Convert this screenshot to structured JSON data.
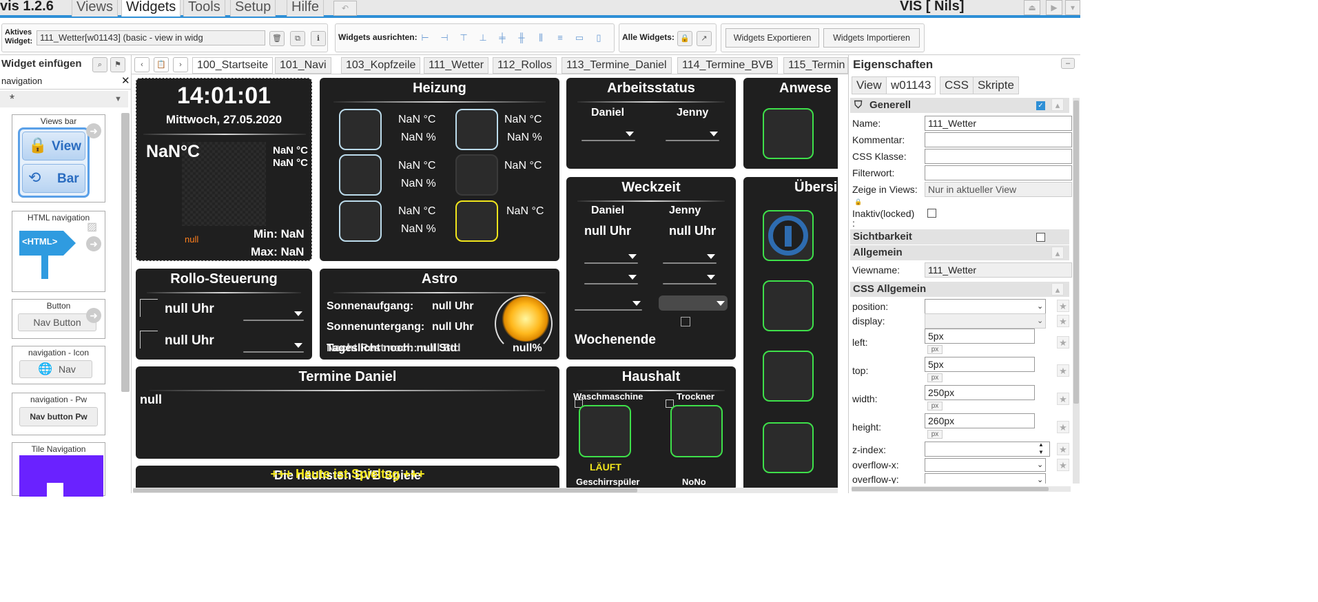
{
  "app": {
    "name": "vis 1.2.6",
    "user_title": "VIS [ Nils]"
  },
  "menu": {
    "tabs": [
      "Views",
      "Widgets",
      "Tools",
      "Setup",
      "Hilfe"
    ],
    "active": "Widgets"
  },
  "toolbar": {
    "active_widget_label_1": "Aktives",
    "active_widget_label_2": "Widget:",
    "active_widget_value": "111_Wetter[w01143] (basic - view in widg",
    "align_label": "Widgets ausrichten:",
    "all_widgets_label": "Alle Widgets:",
    "export_label": "Widgets Exportieren",
    "import_label": "Widgets Importieren"
  },
  "left_panel": {
    "title": "Widget einfügen",
    "filter_value": "navigation",
    "category_value": "*",
    "widgets": [
      {
        "title": "Views bar",
        "items": [
          "View",
          "Bar"
        ]
      },
      {
        "title": "HTML navigation",
        "badge": "<HTML>"
      },
      {
        "title": "Button",
        "button_label": "Nav Button"
      },
      {
        "title": "navigation - Icon",
        "button_label": "Nav"
      },
      {
        "title": "navigation - Pw",
        "button_label": "Nav button Pw"
      },
      {
        "title": "Tile Navigation"
      }
    ]
  },
  "view_tabs": [
    "100_Startseite",
    "101_Navi",
    "103_Kopfzeile",
    "111_Wetter",
    "112_Rollos",
    "113_Termine_Daniel",
    "114_Termine_BVB",
    "115_Termin"
  ],
  "active_view": "100_Startseite",
  "canvas": {
    "clock": {
      "time": "14:01:01",
      "date": "Mittwoch, 27.05.2020",
      "temp": "NaN°C",
      "temp_small_1": "NaN °C",
      "temp_small_2": "NaN °C",
      "null_text": "null",
      "min": "Min: NaN",
      "max": "Max: NaN"
    },
    "heizung": {
      "title": "Heizung",
      "rows": [
        {
          "left_temp": "NaN °C",
          "left_hum": "NaN %",
          "right_temp": "NaN °C",
          "right_hum": "NaN %"
        },
        {
          "left_temp": "NaN °C",
          "left_hum": "NaN %",
          "right_temp": "NaN °C",
          "right_hum": ""
        },
        {
          "left_temp": "NaN °C",
          "left_hum": "NaN %",
          "right_temp": "NaN °C",
          "right_hum": ""
        }
      ]
    },
    "arbeitsstatus": {
      "title": "Arbeitsstatus",
      "person_1": "Daniel",
      "person_2": "Jenny"
    },
    "anwesenheit": {
      "title": "Anwese"
    },
    "weckzeit": {
      "title": "Weckzeit",
      "person_1": "Daniel",
      "person_2": "Jenny",
      "time_1": "null Uhr",
      "time_2": "null Uhr",
      "weekend": "Wochenende"
    },
    "uebersicht": {
      "title": "Übersi"
    },
    "rollo": {
      "title": "Rollo-Steuerung",
      "time_1": "null Uhr",
      "time_2": "null Uhr"
    },
    "astro": {
      "title": "Astro",
      "sunrise_label": "Sonnenaufgang:",
      "sunrise_value": "null Uhr",
      "sunset_label": "Sonnenuntergang:",
      "sunset_value": "null Uhr",
      "overlap_1": "Tageslicht noch: null Std",
      "overlap_2": "Nacht Rest noch: null Std",
      "percent": "null%"
    },
    "termine": {
      "title": "Termine Daniel",
      "content": "null"
    },
    "haushalt": {
      "title": "Haushalt",
      "device_1": "Waschmaschine",
      "device_2": "Trockner",
      "status_1": "LÄUFT",
      "device_3": "Geschirrspüler",
      "device_4": "NoNo"
    },
    "bottom": {
      "text_1": "Die nächsten BVB Spiele",
      "text_2": "+++ Heute ist Spieltag +++"
    }
  },
  "right_panel": {
    "title": "Eigenschaften",
    "tabs": [
      "View",
      "w01143",
      "CSS",
      "Skripte"
    ],
    "active_tab": "w01143",
    "sections": {
      "generell": "Generell",
      "sichtbarkeit": "Sichtbarkeit",
      "allgemein": "Allgemein",
      "css_allgemein": "CSS Allgemein"
    },
    "fields": {
      "name_label": "Name:",
      "name_value": "111_Wetter",
      "kommentar_label": "Kommentar:",
      "css_klasse_label": "CSS Klasse:",
      "filterwort_label": "Filterwort:",
      "zeige_label": "Zeige in Views:",
      "zeige_value": "Nur in aktueller View",
      "inaktiv_label": "Inaktiv(locked)",
      "inaktiv_colon": ":",
      "viewname_label": "Viewname:",
      "viewname_value": "111_Wetter",
      "position_label": "position:",
      "display_label": "display:",
      "left_label": "left:",
      "left_value": "5px",
      "top_label": "top:",
      "top_value": "5px",
      "width_label": "width:",
      "width_value": "250px",
      "height_label": "height:",
      "height_value": "260px",
      "zindex_label": "z-index:",
      "overflowx_label": "overflow-x:",
      "overflowy_label": "overflow-y:",
      "unit": "px"
    }
  },
  "colors": {
    "accent": "#2e8fd6",
    "panel_bg": "#1f1f1f",
    "green_border": "#3ee04a",
    "yellow_border": "#f1e51c",
    "blue_border": "#bcdcec",
    "orange_text": "#ff7f1e"
  }
}
